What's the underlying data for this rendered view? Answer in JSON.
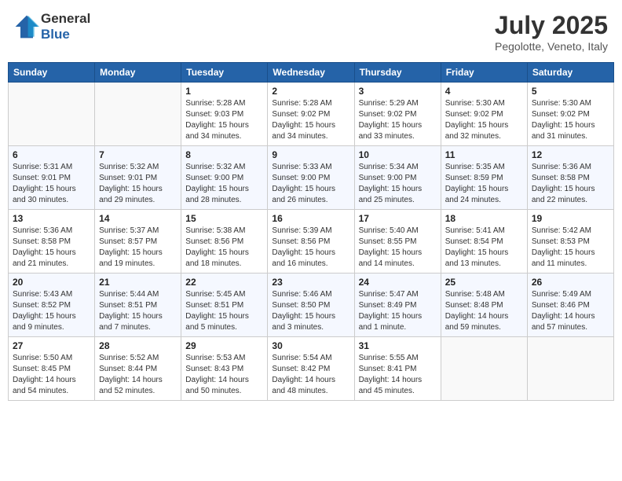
{
  "header": {
    "logo_general": "General",
    "logo_blue": "Blue",
    "month": "July 2025",
    "location": "Pegolotte, Veneto, Italy"
  },
  "days_of_week": [
    "Sunday",
    "Monday",
    "Tuesday",
    "Wednesday",
    "Thursday",
    "Friday",
    "Saturday"
  ],
  "weeks": [
    [
      {
        "day": "",
        "info": ""
      },
      {
        "day": "",
        "info": ""
      },
      {
        "day": "1",
        "sunrise": "Sunrise: 5:28 AM",
        "sunset": "Sunset: 9:03 PM",
        "daylight": "Daylight: 15 hours and 34 minutes."
      },
      {
        "day": "2",
        "sunrise": "Sunrise: 5:28 AM",
        "sunset": "Sunset: 9:02 PM",
        "daylight": "Daylight: 15 hours and 34 minutes."
      },
      {
        "day": "3",
        "sunrise": "Sunrise: 5:29 AM",
        "sunset": "Sunset: 9:02 PM",
        "daylight": "Daylight: 15 hours and 33 minutes."
      },
      {
        "day": "4",
        "sunrise": "Sunrise: 5:30 AM",
        "sunset": "Sunset: 9:02 PM",
        "daylight": "Daylight: 15 hours and 32 minutes."
      },
      {
        "day": "5",
        "sunrise": "Sunrise: 5:30 AM",
        "sunset": "Sunset: 9:02 PM",
        "daylight": "Daylight: 15 hours and 31 minutes."
      }
    ],
    [
      {
        "day": "6",
        "sunrise": "Sunrise: 5:31 AM",
        "sunset": "Sunset: 9:01 PM",
        "daylight": "Daylight: 15 hours and 30 minutes."
      },
      {
        "day": "7",
        "sunrise": "Sunrise: 5:32 AM",
        "sunset": "Sunset: 9:01 PM",
        "daylight": "Daylight: 15 hours and 29 minutes."
      },
      {
        "day": "8",
        "sunrise": "Sunrise: 5:32 AM",
        "sunset": "Sunset: 9:00 PM",
        "daylight": "Daylight: 15 hours and 28 minutes."
      },
      {
        "day": "9",
        "sunrise": "Sunrise: 5:33 AM",
        "sunset": "Sunset: 9:00 PM",
        "daylight": "Daylight: 15 hours and 26 minutes."
      },
      {
        "day": "10",
        "sunrise": "Sunrise: 5:34 AM",
        "sunset": "Sunset: 9:00 PM",
        "daylight": "Daylight: 15 hours and 25 minutes."
      },
      {
        "day": "11",
        "sunrise": "Sunrise: 5:35 AM",
        "sunset": "Sunset: 8:59 PM",
        "daylight": "Daylight: 15 hours and 24 minutes."
      },
      {
        "day": "12",
        "sunrise": "Sunrise: 5:36 AM",
        "sunset": "Sunset: 8:58 PM",
        "daylight": "Daylight: 15 hours and 22 minutes."
      }
    ],
    [
      {
        "day": "13",
        "sunrise": "Sunrise: 5:36 AM",
        "sunset": "Sunset: 8:58 PM",
        "daylight": "Daylight: 15 hours and 21 minutes."
      },
      {
        "day": "14",
        "sunrise": "Sunrise: 5:37 AM",
        "sunset": "Sunset: 8:57 PM",
        "daylight": "Daylight: 15 hours and 19 minutes."
      },
      {
        "day": "15",
        "sunrise": "Sunrise: 5:38 AM",
        "sunset": "Sunset: 8:56 PM",
        "daylight": "Daylight: 15 hours and 18 minutes."
      },
      {
        "day": "16",
        "sunrise": "Sunrise: 5:39 AM",
        "sunset": "Sunset: 8:56 PM",
        "daylight": "Daylight: 15 hours and 16 minutes."
      },
      {
        "day": "17",
        "sunrise": "Sunrise: 5:40 AM",
        "sunset": "Sunset: 8:55 PM",
        "daylight": "Daylight: 15 hours and 14 minutes."
      },
      {
        "day": "18",
        "sunrise": "Sunrise: 5:41 AM",
        "sunset": "Sunset: 8:54 PM",
        "daylight": "Daylight: 15 hours and 13 minutes."
      },
      {
        "day": "19",
        "sunrise": "Sunrise: 5:42 AM",
        "sunset": "Sunset: 8:53 PM",
        "daylight": "Daylight: 15 hours and 11 minutes."
      }
    ],
    [
      {
        "day": "20",
        "sunrise": "Sunrise: 5:43 AM",
        "sunset": "Sunset: 8:52 PM",
        "daylight": "Daylight: 15 hours and 9 minutes."
      },
      {
        "day": "21",
        "sunrise": "Sunrise: 5:44 AM",
        "sunset": "Sunset: 8:51 PM",
        "daylight": "Daylight: 15 hours and 7 minutes."
      },
      {
        "day": "22",
        "sunrise": "Sunrise: 5:45 AM",
        "sunset": "Sunset: 8:51 PM",
        "daylight": "Daylight: 15 hours and 5 minutes."
      },
      {
        "day": "23",
        "sunrise": "Sunrise: 5:46 AM",
        "sunset": "Sunset: 8:50 PM",
        "daylight": "Daylight: 15 hours and 3 minutes."
      },
      {
        "day": "24",
        "sunrise": "Sunrise: 5:47 AM",
        "sunset": "Sunset: 8:49 PM",
        "daylight": "Daylight: 15 hours and 1 minute."
      },
      {
        "day": "25",
        "sunrise": "Sunrise: 5:48 AM",
        "sunset": "Sunset: 8:48 PM",
        "daylight": "Daylight: 14 hours and 59 minutes."
      },
      {
        "day": "26",
        "sunrise": "Sunrise: 5:49 AM",
        "sunset": "Sunset: 8:46 PM",
        "daylight": "Daylight: 14 hours and 57 minutes."
      }
    ],
    [
      {
        "day": "27",
        "sunrise": "Sunrise: 5:50 AM",
        "sunset": "Sunset: 8:45 PM",
        "daylight": "Daylight: 14 hours and 54 minutes."
      },
      {
        "day": "28",
        "sunrise": "Sunrise: 5:52 AM",
        "sunset": "Sunset: 8:44 PM",
        "daylight": "Daylight: 14 hours and 52 minutes."
      },
      {
        "day": "29",
        "sunrise": "Sunrise: 5:53 AM",
        "sunset": "Sunset: 8:43 PM",
        "daylight": "Daylight: 14 hours and 50 minutes."
      },
      {
        "day": "30",
        "sunrise": "Sunrise: 5:54 AM",
        "sunset": "Sunset: 8:42 PM",
        "daylight": "Daylight: 14 hours and 48 minutes."
      },
      {
        "day": "31",
        "sunrise": "Sunrise: 5:55 AM",
        "sunset": "Sunset: 8:41 PM",
        "daylight": "Daylight: 14 hours and 45 minutes."
      },
      {
        "day": "",
        "info": ""
      },
      {
        "day": "",
        "info": ""
      }
    ]
  ]
}
